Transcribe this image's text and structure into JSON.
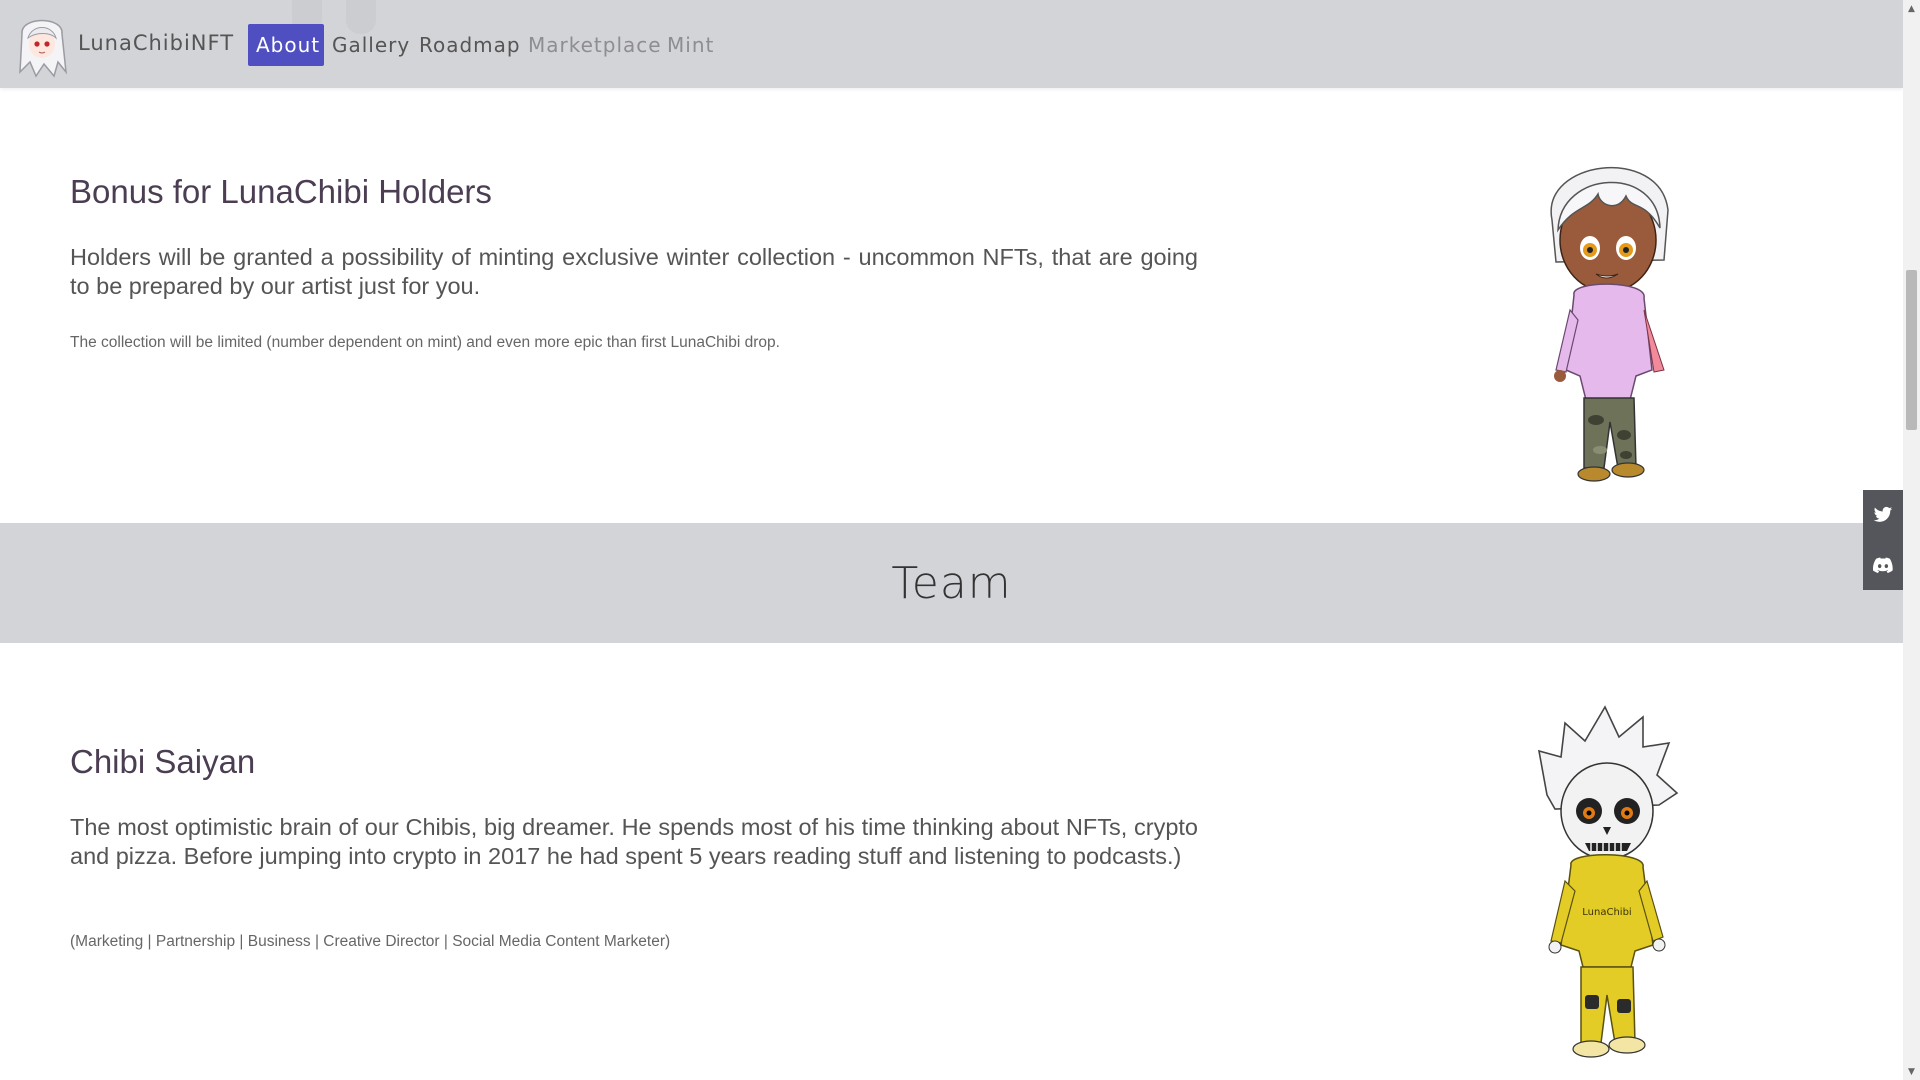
{
  "navbar": {
    "brand": "LunaChibiNFT",
    "links": [
      {
        "label": "About"
      },
      {
        "label": "Gallery"
      },
      {
        "label": "Roadmap"
      },
      {
        "label": "Marketplace"
      },
      {
        "label": "Mint"
      }
    ]
  },
  "bonus": {
    "title": "Bonus for LunaChibi Holders",
    "lead": "Holders will be granted a possibility of minting exclusive winter collection - uncommon NFTs, that are going to be prepared by our artist just for you.",
    "note": "The collection will be limited (number dependent on mint) and even more epic than first LunaChibi drop."
  },
  "team": {
    "title": "Team",
    "members": [
      {
        "name": "Chibi Saiyan",
        "bio": "The most optimistic brain of our Chibis, big dreamer. He spends most of his time thinking about NFTs, crypto and pizza. Before jumping into crypto in 2017 he had spent 5 years reading stuff and listening to podcasts.)",
        "roles": "(Marketing | Partnership | Business | Creative Director | Social Media Content Marketer)",
        "hoodie_text": "LunaChibi"
      }
    ]
  },
  "social": [
    "twitter-icon",
    "discord-icon"
  ],
  "colors": {
    "navbar_bg": "#d3d4d8",
    "active_link": "#4f4fc2",
    "band_bg": "#d3d4d8",
    "social_bg": "#55565b"
  }
}
